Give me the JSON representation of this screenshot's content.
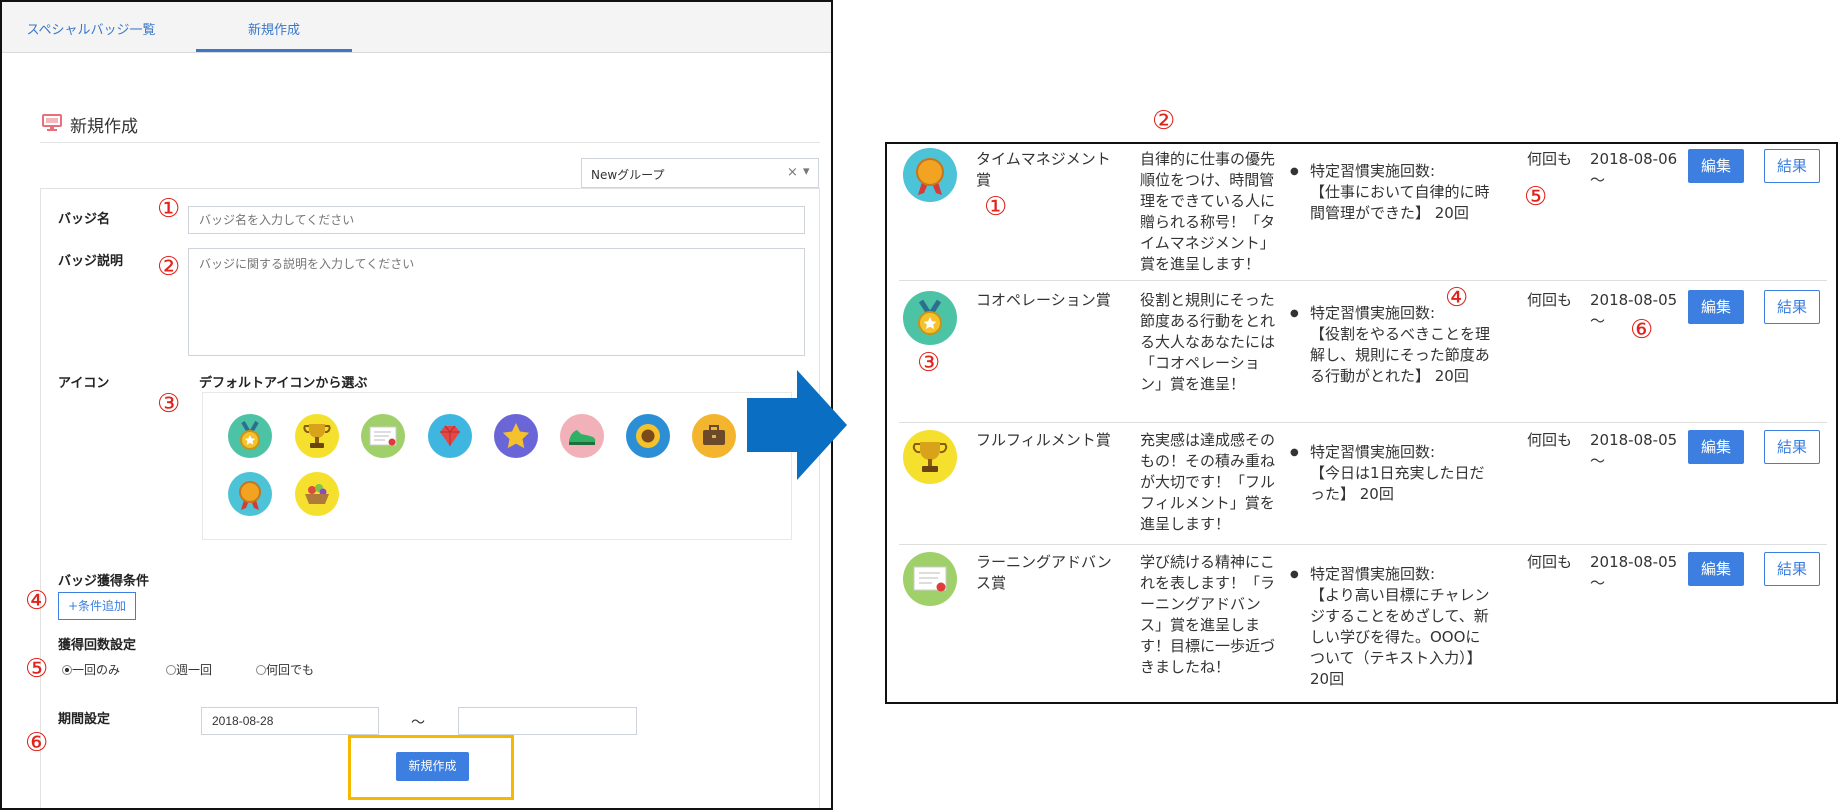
{
  "form": {
    "tabs": [
      "スペシャルバッジ一覧",
      "新規作成"
    ],
    "section_title": "新規作成",
    "group_select": {
      "value": "Newグループ",
      "clear": "×",
      "arrow": "▾"
    },
    "badge_name": {
      "label": "バッジ名",
      "placeholder": "バッジ名を入力してください"
    },
    "badge_desc": {
      "label": "バッジ説明",
      "placeholder": "バッジに関する説明を入力してください"
    },
    "icon": {
      "label": "アイコン",
      "sub_label": "デフォルトアイコンから選ぶ",
      "options": [
        "medal-teal-icon",
        "trophy-gold-icon",
        "certificate-icon",
        "gem-icon",
        "star-icon",
        "sneaker-icon",
        "sunflower-icon",
        "briefcase-icon",
        "medal-orange-icon",
        "basket-icon"
      ]
    },
    "condition": {
      "label": "バッジ獲得条件",
      "add_button": "+条件追加"
    },
    "frequency": {
      "label": "獲得回数設定",
      "options": [
        "一回のみ",
        "週一回",
        "何回でも"
      ],
      "selected": "一回のみ"
    },
    "period": {
      "label": "期間設定",
      "start": "2018-08-28",
      "separator": "〜",
      "end": ""
    },
    "submit_button": "新規作成"
  },
  "table": {
    "rows": [
      {
        "icon": "medal-orange-icon",
        "name": "タイムマネジメント賞",
        "description": "自律的に仕事の優先順位をつけ、時間管理をできている人に贈られる称号！「タイムマネジメント」賞を進呈します！",
        "condition_heading": "特定習慣実施回数:",
        "condition_text": "【仕事において自律的に時間管理ができた】 20回",
        "frequency": "何回も",
        "date": "2018-08-06",
        "date_suffix": "〜",
        "edit": "編集",
        "result": "結果"
      },
      {
        "icon": "medal-teal-icon",
        "name": "コオペレーション賞",
        "description": "役割と規則にそった節度ある行動をとれる大人なあなたには「コオペレーション」賞を進呈！",
        "condition_heading": "特定習慣実施回数:",
        "condition_text": "【役割をやるべきことを理解し、規則にそった節度ある行動がとれた】 20回",
        "frequency": "何回も",
        "date": "2018-08-05",
        "date_suffix": "〜",
        "edit": "編集",
        "result": "結果"
      },
      {
        "icon": "trophy-gold-icon",
        "name": "フルフィルメント賞",
        "description": "充実感は達成感そのもの！その積み重ねが大切です！「フルフィルメント」賞を進呈します！",
        "condition_heading": "特定習慣実施回数:",
        "condition_text": "【今日は1日充実した日だった】 20回",
        "frequency": "何回も",
        "date": "2018-08-05",
        "date_suffix": "〜",
        "edit": "編集",
        "result": "結果"
      },
      {
        "icon": "certificate-icon",
        "name": "ラーニングアドバンス賞",
        "description": "学び続ける精神にこれを表します！「ラーニングアドバンス」賞を進呈します！目標に一歩近づきましたね！",
        "condition_heading": "特定習慣実施回数:",
        "condition_text": "【より高い目標にチャレンジすることをめざして、新しい学びを得た。OOOについて（テキスト入力）】 20回",
        "frequency": "何回も",
        "date": "2018-08-05",
        "date_suffix": "〜",
        "edit": "編集",
        "result": "結果"
      }
    ]
  },
  "markers": [
    "①",
    "②",
    "③",
    "④",
    "⑤",
    "⑥"
  ],
  "colors": {
    "accent": "#3c7fe0",
    "annotation": "#e0231c",
    "highlight": "#f5b800",
    "arrow": "#0a6fc2"
  }
}
